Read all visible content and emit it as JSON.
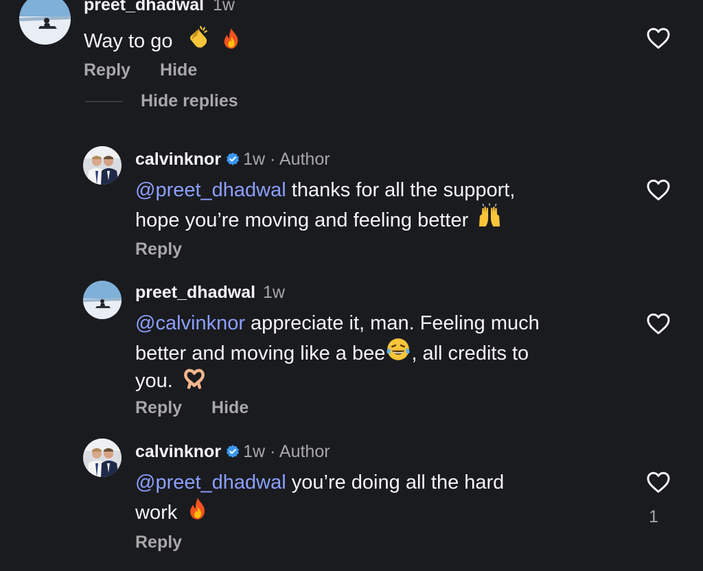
{
  "colors": {
    "background": "#1a1b1f",
    "text": "#f5f5f5",
    "muted": "#a8a8a8",
    "mention": "#8c9fff",
    "verified": "#3897f0"
  },
  "top_comment": {
    "username": "preet_dhadwal",
    "time": "1w",
    "text": "Way to go",
    "emojis": [
      "clapping-hands-emoji",
      "fire-emoji"
    ],
    "actions": [
      "Reply",
      "Hide"
    ]
  },
  "hide_replies_label": "Hide replies",
  "replies": [
    {
      "username": "calvinknor",
      "verified": true,
      "time": "1w",
      "separator": "·",
      "badge": "Author",
      "mention": "@preet_dhadwal",
      "text_line1": " thanks for all the support,",
      "text_line2": "hope you’re moving and feeling better",
      "emoji": "raising-hands-emoji",
      "actions": [
        "Reply"
      ]
    },
    {
      "username": "preet_dhadwal",
      "verified": false,
      "time": "1w",
      "mention": "@calvinknor",
      "text_line1": " appreciate it, man. Feeling much",
      "text_line2a": "better and moving like a bee",
      "text_line2b": ", all credits to",
      "text_line3": "you.",
      "emojis": [
        "tears-of-joy-emoji",
        "heart-hands-emoji"
      ],
      "actions": [
        "Reply",
        "Hide"
      ]
    },
    {
      "username": "calvinknor",
      "verified": true,
      "time": "1w",
      "separator": "·",
      "badge": "Author",
      "mention": "@preet_dhadwal",
      "text_line1": " you’re doing all the hard",
      "text_line2": "work",
      "emoji": "fire-emoji",
      "actions": [
        "Reply"
      ],
      "like_count": "1"
    }
  ]
}
